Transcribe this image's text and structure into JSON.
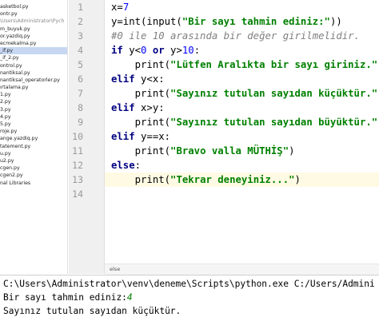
{
  "sidebar": {
    "items": [
      {
        "label": "asketbol.py"
      },
      {
        "label": "ontr.py"
      },
      {
        "label": "\\Users\\Administrator\\Pych",
        "path": true
      },
      {
        "label": "m_buyuk.py"
      },
      {
        "label": "or.yazdiq.py"
      },
      {
        "label": "ecmekalma.py"
      },
      {
        "label": "_if.py",
        "selected": true
      },
      {
        "label": "_if_2.py"
      },
      {
        "label": "ontrol.py"
      },
      {
        "label": "nantiksal.py"
      },
      {
        "label": "nantiksal_operatorler.py"
      },
      {
        "label": "ırtalama.py"
      },
      {
        "label": "1.py"
      },
      {
        "label": "2.py"
      },
      {
        "label": "3.py"
      },
      {
        "label": "4.py"
      },
      {
        "label": "5.py"
      },
      {
        "label": "roje.py"
      },
      {
        "label": "ange.yazdiq.py"
      },
      {
        "label": "tatement.py"
      },
      {
        "label": "u.py"
      },
      {
        "label": "u2.py"
      },
      {
        "label": "cgen.py"
      },
      {
        "label": "cgen2.py"
      },
      {
        "label": "nal Libraries"
      }
    ]
  },
  "editor": {
    "line_numbers": [
      "1",
      "2",
      "3",
      "4",
      "5",
      "6",
      "7",
      "8",
      "9",
      "10",
      "11",
      "12",
      "13",
      "14"
    ],
    "current_line": 13,
    "lines": [
      [
        {
          "t": "x=",
          "c": ""
        },
        {
          "t": "7",
          "c": "num"
        }
      ],
      [
        {
          "t": "y=int(input(",
          "c": ""
        },
        {
          "t": "\"Bir sayı tahmin ediniz:\"",
          "c": "str"
        },
        {
          "t": "))",
          "c": ""
        }
      ],
      [
        {
          "t": "#0 ile 10 arasında bir değer girilmelidir.",
          "c": "cmt"
        }
      ],
      [
        {
          "t": "if",
          "c": "kw"
        },
        {
          "t": " y<",
          "c": ""
        },
        {
          "t": "0",
          "c": "num"
        },
        {
          "t": " ",
          "c": ""
        },
        {
          "t": "or",
          "c": "kw"
        },
        {
          "t": " y>",
          "c": ""
        },
        {
          "t": "10",
          "c": "num"
        },
        {
          "t": ":",
          "c": ""
        }
      ],
      [
        {
          "t": "    print(",
          "c": ""
        },
        {
          "t": "\"Lütfen Aralıkta bir sayı giriniz.\"",
          "c": "str"
        },
        {
          "t": ")",
          "c": ""
        }
      ],
      [
        {
          "t": "elif",
          "c": "kw"
        },
        {
          "t": " y<x:",
          "c": ""
        }
      ],
      [
        {
          "t": "    print(",
          "c": ""
        },
        {
          "t": "\"Sayınız tutulan sayıdan küçüktür.\"",
          "c": "str"
        },
        {
          "t": ")",
          "c": ""
        }
      ],
      [
        {
          "t": "elif",
          "c": "kw"
        },
        {
          "t": " x>y:",
          "c": ""
        }
      ],
      [
        {
          "t": "    print(",
          "c": ""
        },
        {
          "t": "\"Sayınız tutulan sayıdan büyüktür.\"",
          "c": "str"
        },
        {
          "t": ")",
          "c": ""
        }
      ],
      [
        {
          "t": "elif",
          "c": "kw"
        },
        {
          "t": " y==x:",
          "c": ""
        }
      ],
      [
        {
          "t": "    print(",
          "c": ""
        },
        {
          "t": "\"Bravo valla MÜTHİŞ\"",
          "c": "str"
        },
        {
          "t": ")",
          "c": ""
        }
      ],
      [
        {
          "t": "else",
          "c": "kw"
        },
        {
          "t": ":",
          "c": ""
        }
      ],
      [
        {
          "t": "    print(",
          "c": ""
        },
        {
          "t": "\"Tekrar deneyiniz...\"",
          "c": "str"
        },
        {
          "t": ")",
          "c": ""
        }
      ],
      []
    ]
  },
  "breadcrumb": {
    "label": "else"
  },
  "console": {
    "command": "C:\\Users\\Administrator\\venv\\deneme\\Scripts\\python.exe C:/Users/Admini",
    "prompt": "Bir sayı tahmin ediniz:",
    "user_input": "4",
    "output": "Sayınız tutulan sayıdan küçüktür."
  }
}
